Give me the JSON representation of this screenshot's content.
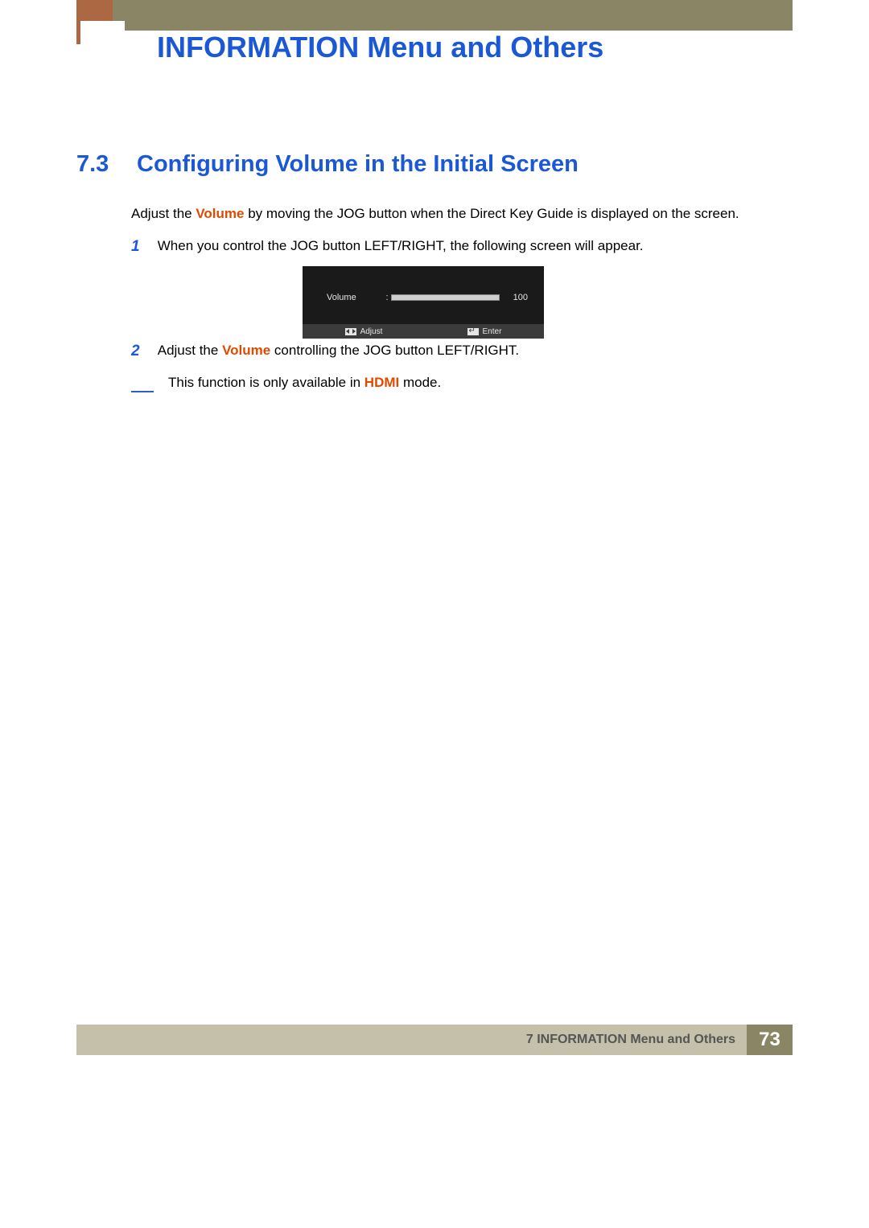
{
  "header": {
    "title": "INFORMATION Menu and Others"
  },
  "section": {
    "number": "7.3",
    "title": "Configuring Volume in the Initial Screen"
  },
  "intro": {
    "pre": "Adjust the ",
    "highlight": "Volume",
    "post": " by moving the JOG button when the Direct Key Guide is displayed on the screen."
  },
  "steps": {
    "s1": {
      "n": "1",
      "text": "When you control the JOG button LEFT/RIGHT, the following screen will appear."
    },
    "s2": {
      "n": "2",
      "pre": "Adjust the ",
      "highlight": "Volume",
      "post": " controlling the JOG button LEFT/RIGHT."
    }
  },
  "osd": {
    "label": "Volume",
    "colon": ":",
    "value": "100",
    "adjust": "Adjust",
    "enter": "Enter"
  },
  "note": {
    "pre": "This function is only available in ",
    "highlight": "HDMI",
    "post": " mode."
  },
  "footer": {
    "text": "7 INFORMATION Menu and Others",
    "page": "73"
  }
}
